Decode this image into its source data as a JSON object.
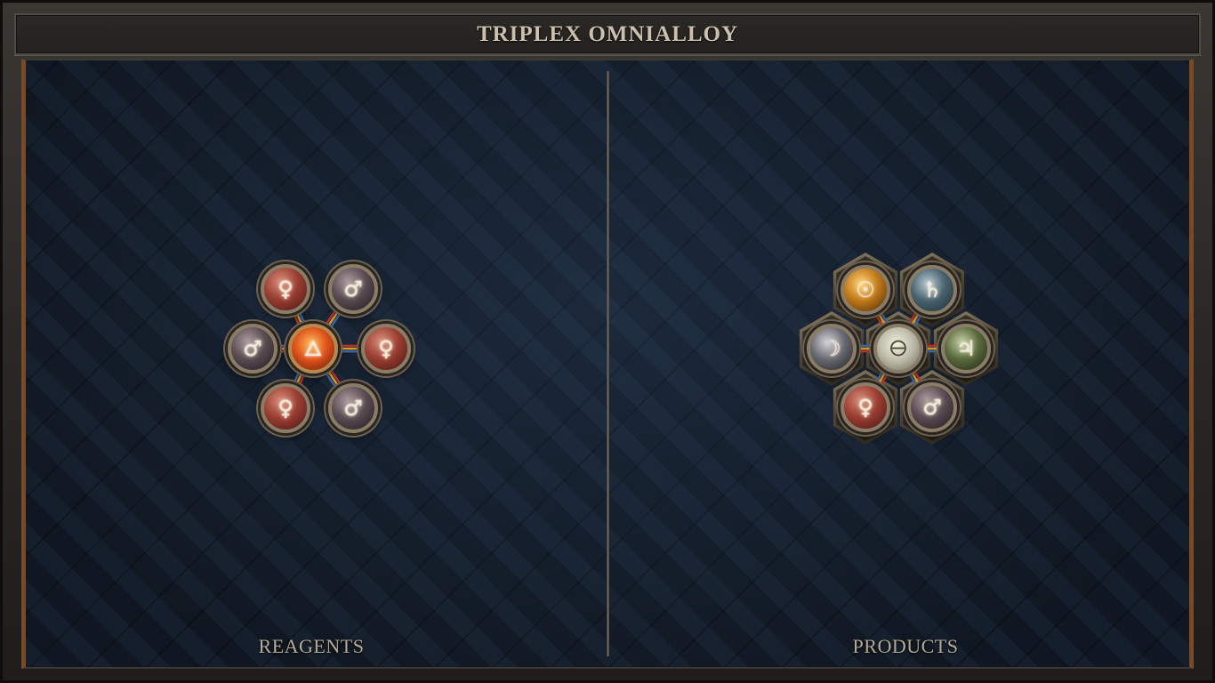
{
  "title": "TRIPLEX OMNIALLOY",
  "panels": {
    "reagents": {
      "label": "REAGENTS",
      "center": {
        "element": "fire",
        "symbol": "🜂"
      },
      "atoms": [
        {
          "element": "copper",
          "symbol": "♀"
        },
        {
          "element": "iron",
          "symbol": "♂"
        },
        {
          "element": "copper",
          "symbol": "♀"
        },
        {
          "element": "iron",
          "symbol": "♂"
        },
        {
          "element": "copper",
          "symbol": "♀"
        },
        {
          "element": "iron",
          "symbol": "♂"
        }
      ]
    },
    "products": {
      "label": "PRODUCTS",
      "center": {
        "element": "salt",
        "symbol": "🜔"
      },
      "atoms": [
        {
          "element": "gold",
          "symbol": "☉"
        },
        {
          "element": "lead",
          "symbol": "♄"
        },
        {
          "element": "tin",
          "symbol": "♃"
        },
        {
          "element": "iron",
          "symbol": "♂"
        },
        {
          "element": "copper",
          "symbol": "♀"
        },
        {
          "element": "silver",
          "symbol": "☽"
        }
      ]
    }
  },
  "colors": {
    "frame_wood": "#7a4a24",
    "board_bg": "#172232",
    "title_text": "#cbc0ad",
    "bond_red": "#c0302a",
    "bond_yellow": "#d6a12a",
    "bond_blue": "#3a68a8"
  }
}
